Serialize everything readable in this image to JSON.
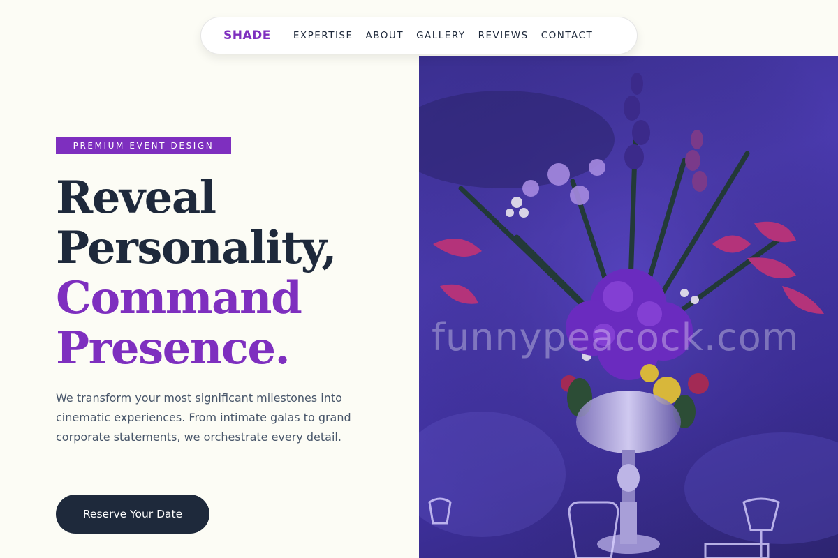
{
  "nav": {
    "logo": "SHADE",
    "links": [
      "EXPERTISE",
      "ABOUT",
      "GALLERY",
      "REVIEWS",
      "CONTACT"
    ]
  },
  "hero": {
    "badge": "PREMIUM EVENT DESIGN",
    "headline_line1": "Reveal",
    "headline_line2": "Personality,",
    "headline_line3": "Command",
    "headline_line4": "Presence.",
    "description": "We transform your most significant milestones into cinematic experiences. From intimate galas to grand corporate statements, we orchestrate every detail.",
    "cta_label": "Reserve Your Date",
    "image_watermark": "funnypeacock.com"
  },
  "colors": {
    "accent": "#7e2fbf",
    "dark": "#1e293b",
    "background": "#fcfcf5",
    "body_text": "#475569"
  }
}
